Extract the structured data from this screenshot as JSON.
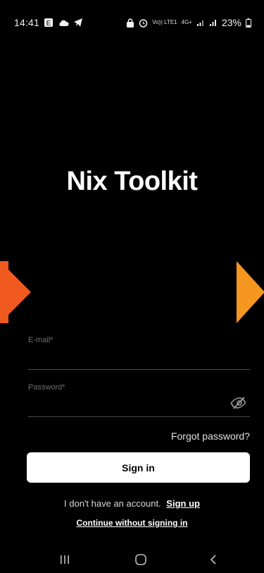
{
  "status_bar": {
    "time": "14:41",
    "left_icons": [
      "notification-badge-icon",
      "cloud-icon",
      "telegram-icon"
    ],
    "right_icons": [
      "lock-icon",
      "alarm-icon",
      "volte-icon",
      "4g-icon",
      "signal-icon",
      "signal-icon-2",
      "battery-icon"
    ],
    "volte_text": "Vo)) LTE1",
    "network_text": "4G+",
    "battery_percent": "23%"
  },
  "app": {
    "title": "Nix Toolkit"
  },
  "form": {
    "email_label": "E-mail*",
    "password_label": "Password*",
    "password_visibility_icon": "eye-off-icon",
    "forgot_password": "Forgot password?",
    "sign_in_label": "Sign in"
  },
  "footer": {
    "no_account_text": "I don't have an account.",
    "sign_up_label": "Sign up",
    "continue_label": "Continue without signing in"
  },
  "colors": {
    "background": "#000000",
    "button_bg": "#ffffff",
    "arrow_left": "#f0591f",
    "arrow_right": "#f4961f",
    "label": "#6f6f6f",
    "divider": "#4a4a4a"
  },
  "nav_bar": {
    "icons": [
      "recents-icon",
      "home-icon",
      "back-icon"
    ]
  }
}
